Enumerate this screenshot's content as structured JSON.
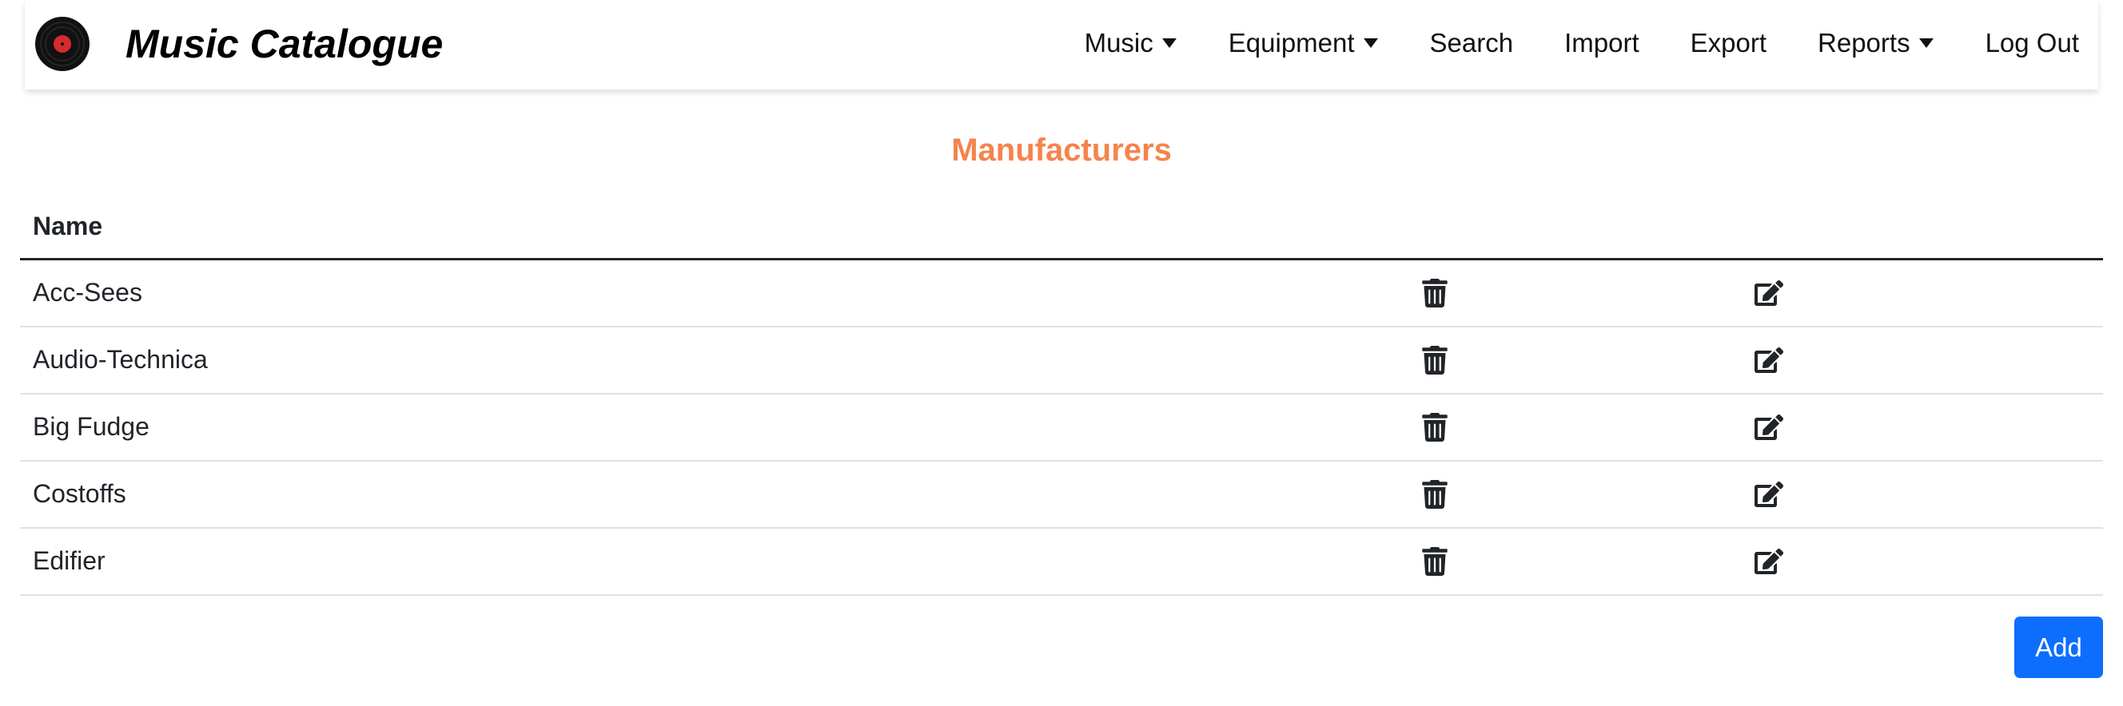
{
  "navbar": {
    "brand_title": "Music Catalogue",
    "logo_icon": "vinyl-record-icon",
    "items": [
      {
        "label": "Music",
        "has_dropdown": true
      },
      {
        "label": "Equipment",
        "has_dropdown": true
      },
      {
        "label": "Search",
        "has_dropdown": false
      },
      {
        "label": "Import",
        "has_dropdown": false
      },
      {
        "label": "Export",
        "has_dropdown": false
      },
      {
        "label": "Reports",
        "has_dropdown": true
      },
      {
        "label": "Log Out",
        "has_dropdown": false
      }
    ]
  },
  "page": {
    "title": "Manufacturers",
    "title_color": "#f4844c"
  },
  "table": {
    "columns": [
      "Name"
    ],
    "rows": [
      {
        "name": "Acc-Sees"
      },
      {
        "name": "Audio-Technica"
      },
      {
        "name": "Big Fudge"
      },
      {
        "name": "Costoffs"
      },
      {
        "name": "Edifier"
      }
    ],
    "row_actions": [
      "trash-icon",
      "edit-icon"
    ]
  },
  "actions": {
    "add_label": "Add",
    "add_color": "#0d6efd"
  }
}
